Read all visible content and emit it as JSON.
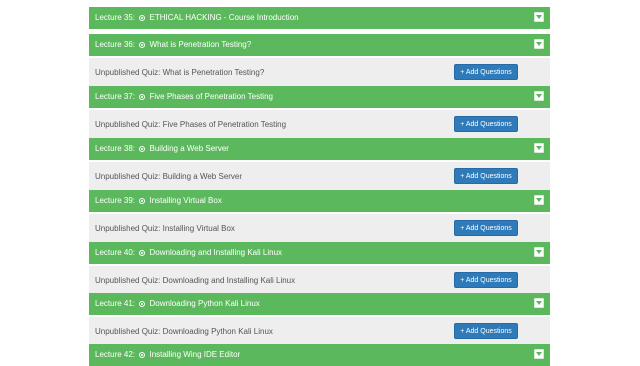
{
  "colors": {
    "lecture_bg": "#5cb85c",
    "quiz_bg": "#eeeeee",
    "button_bg": "#2f7ab9"
  },
  "curriculum": {
    "items": [
      {
        "kind": "lecture",
        "label": "Lecture 35:",
        "title": "ETHICAL HACKING - Course Introduction"
      },
      {
        "kind": "lecture",
        "label": "Lecture 36:",
        "title": "What is Penetration Testing?"
      },
      {
        "kind": "quiz",
        "text": "Unpublished Quiz: What is Penetration Testing?",
        "button": "+ Add Questions"
      },
      {
        "kind": "lecture",
        "label": "Lecture 37:",
        "title": "Five Phases of Penetration Testing"
      },
      {
        "kind": "quiz",
        "text": "Unpublished Quiz: Five Phases of Penetration Testing",
        "button": "+ Add Questions"
      },
      {
        "kind": "lecture",
        "label": "Lecture 38:",
        "title": "Building a Web Server"
      },
      {
        "kind": "quiz",
        "text": "Unpublished Quiz: Building a Web Server",
        "button": "+ Add Questions"
      },
      {
        "kind": "lecture",
        "label": "Lecture 39:",
        "title": "Installing Virtual Box"
      },
      {
        "kind": "quiz",
        "text": "Unpublished Quiz: Installing Virtual Box",
        "button": "+ Add Questions"
      },
      {
        "kind": "lecture",
        "label": "Lecture 40:",
        "title": "Downloading and Installing Kali Linux"
      },
      {
        "kind": "quiz",
        "text": "Unpublished Quiz: Downloading and Installing Kali Linux",
        "button": "+ Add Questions"
      },
      {
        "kind": "lecture",
        "label": "Lecture 41:",
        "title": "Downloading Python Kali Linux"
      },
      {
        "kind": "quiz",
        "text": "Unpublished Quiz: Downloading Python Kali Linux",
        "button": "+ Add Questions"
      },
      {
        "kind": "lecture",
        "label": "Lecture 42:",
        "title": "Installing Wing IDE Editor"
      }
    ]
  }
}
